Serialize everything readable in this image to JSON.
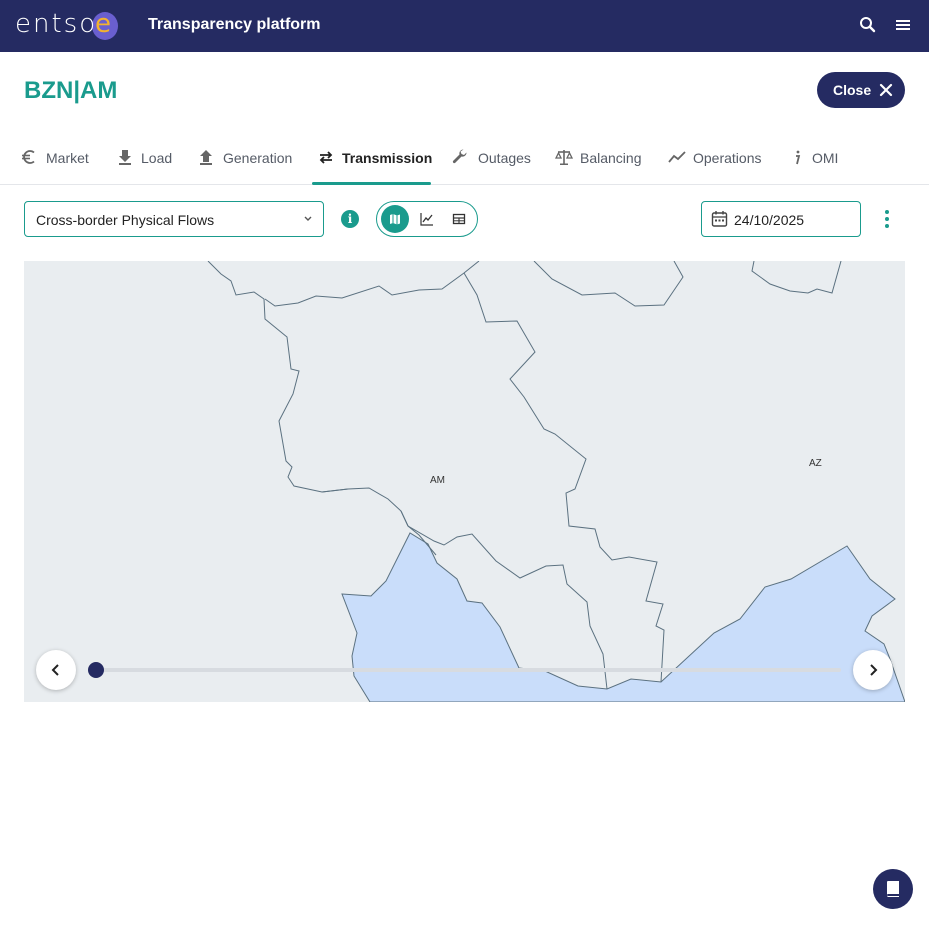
{
  "header": {
    "logo_text": "entso",
    "logo_e": "e",
    "app_title": "Transparency platform",
    "search_icon": "search-icon",
    "menu_icon": "hamburger-menu-icon"
  },
  "page": {
    "title": "BZN|AM",
    "close_label": "Close"
  },
  "tabs": [
    {
      "label": "Market",
      "icon": "euro-icon",
      "active": false
    },
    {
      "label": "Load",
      "icon": "download-icon",
      "active": false
    },
    {
      "label": "Generation",
      "icon": "upload-icon",
      "active": false
    },
    {
      "label": "Transmission",
      "icon": "swap-arrows-icon",
      "active": true
    },
    {
      "label": "Outages",
      "icon": "wrench-icon",
      "active": false
    },
    {
      "label": "Balancing",
      "icon": "scale-icon",
      "active": false
    },
    {
      "label": "Operations",
      "icon": "trend-line-icon",
      "active": false
    },
    {
      "label": "OMI",
      "icon": "info-italic-icon",
      "active": false
    }
  ],
  "toolbar": {
    "dataset_select": "Cross-border Physical Flows",
    "date": "24/10/2025",
    "view_modes": [
      "map",
      "chart",
      "table"
    ],
    "active_view": "map"
  },
  "map": {
    "labels": [
      "AM",
      "AZ"
    ],
    "timeline_position": 0
  },
  "colors": {
    "primary": "#252b62",
    "accent": "#1a9b8d",
    "water": "#c9ddfa",
    "land": "#e9edf0"
  }
}
